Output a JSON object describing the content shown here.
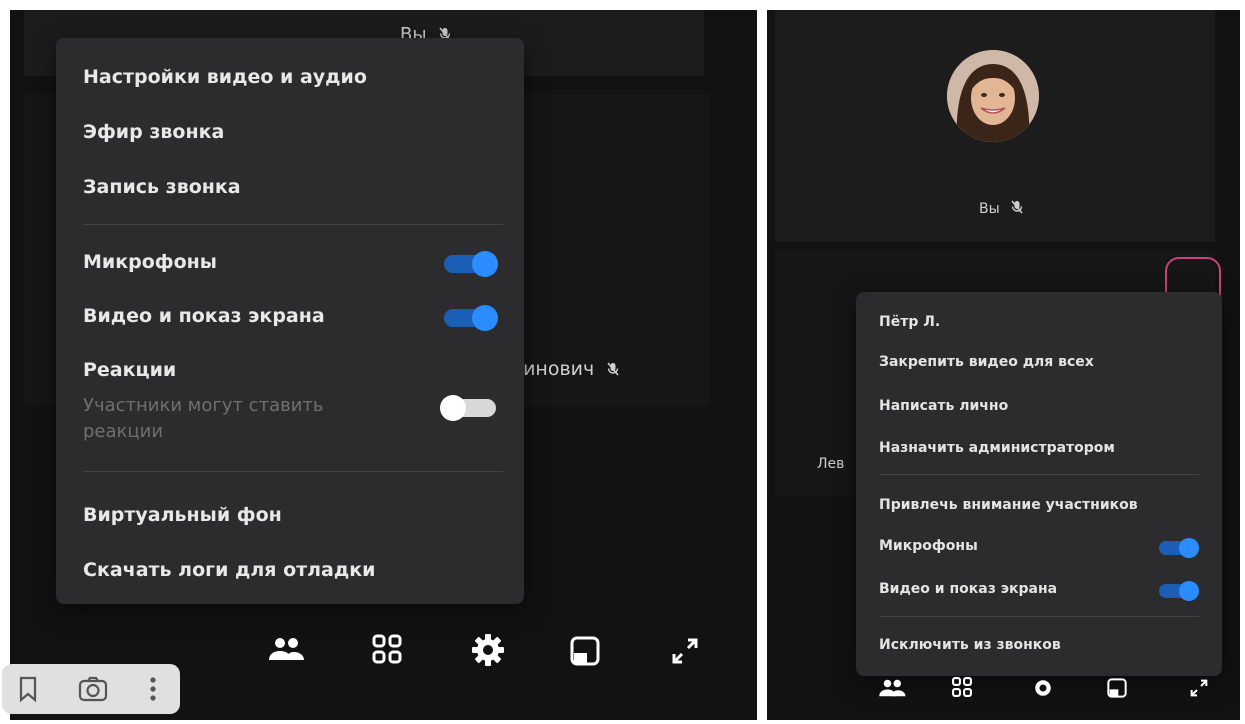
{
  "left": {
    "tile_top_label": "Вы",
    "tile_name_partial": "тинович",
    "settings_menu": {
      "video_audio_settings": "Настройки видео и аудио",
      "call_broadcast": "Эфир звонка",
      "call_recording": "Запись звонка",
      "microphones": "Микрофоны",
      "video_screen_share": "Видео и показ экрана",
      "reactions": "Реакции",
      "reactions_sub": "Участники могут ставить реакции",
      "virtual_background": "Виртуальный фон",
      "download_logs": "Скачать логи для отладки",
      "toggles": {
        "microphones": true,
        "video_screen_share": true,
        "reactions": false
      }
    }
  },
  "right": {
    "self_label": "Вы",
    "other_name_partial": "Лев",
    "participant_menu": {
      "name": "Пётр Л.",
      "pin_video": "Закрепить видео для всех",
      "write_private": "Написать лично",
      "make_admin": "Назначить администратором",
      "attract_attention": "Привлечь внимание участников",
      "microphones": "Микрофоны",
      "video_screen_share": "Видео и показ экрана",
      "remove_from_calls": "Исключить из звонков",
      "toggles": {
        "microphones": true,
        "video_screen_share": true
      }
    }
  },
  "toolbar_icons": [
    "people-icon",
    "grid-icon",
    "gear-icon",
    "layout-icon",
    "expand-icon"
  ],
  "bookmark_bar_icons": [
    "bookmark-icon",
    "camera-icon",
    "more-vertical-icon"
  ],
  "colors": {
    "panel_bg": "#121212",
    "menu_bg": "#2c2c2e",
    "toggle_on": "#2a8cff",
    "highlight_ring": "#c8427a"
  }
}
